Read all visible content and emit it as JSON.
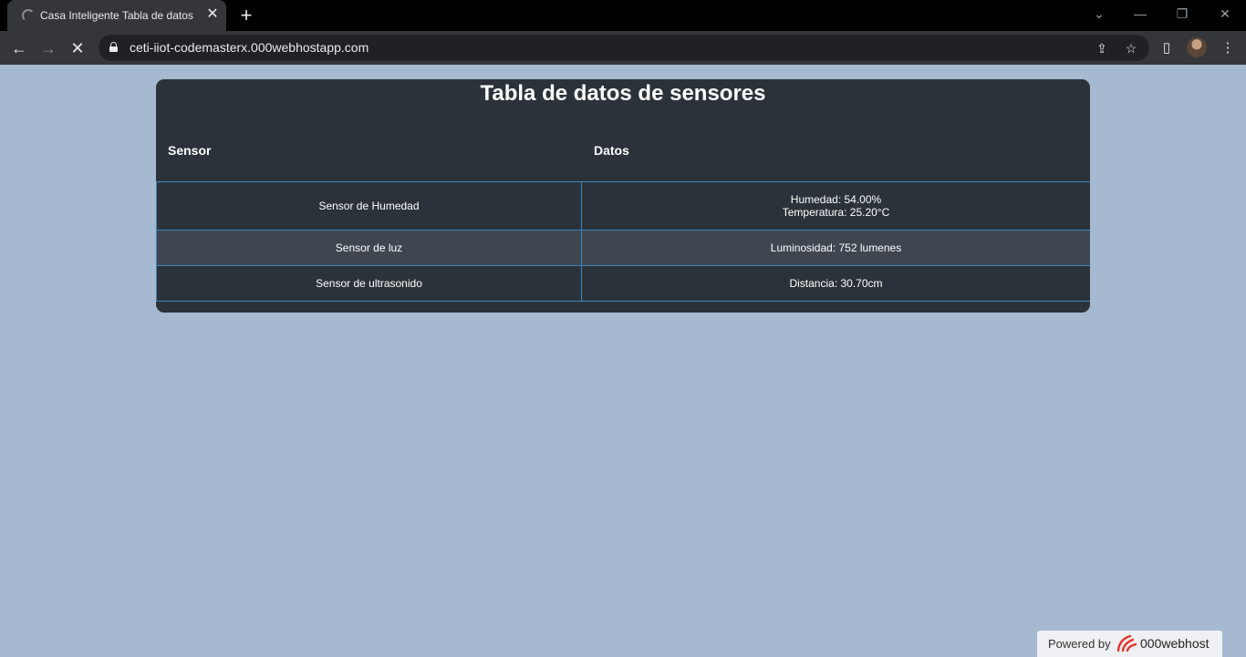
{
  "browser": {
    "tab_title": "Casa Inteligente Tabla de datos",
    "tab_close": "✕",
    "new_tab": "+",
    "url": "ceti-iiot-codemasterx.000webhostapp.com",
    "window_controls": {
      "tab_search": "⌄",
      "minimize": "—",
      "restore": "❐",
      "close": "✕"
    },
    "nav": {
      "back": "←",
      "forward": "→",
      "stop": "✕"
    },
    "icons": {
      "share": "⇪",
      "bookmark": "☆",
      "side_panel": "▯",
      "menu": "⋮"
    }
  },
  "page": {
    "title": "Tabla de datos de sensores",
    "columns": [
      "Sensor",
      "Datos"
    ],
    "rows": [
      {
        "sensor": "Sensor de Humedad",
        "datos_line1": "Humedad: 54.00%",
        "datos_line2": "Temperatura: 25.20°C"
      },
      {
        "sensor": "Sensor de luz",
        "datos_line1": "Luminosidad: 752 lumenes",
        "datos_line2": ""
      },
      {
        "sensor": "Sensor de ultrasonido",
        "datos_line1": "Distancia: 30.70cm",
        "datos_line2": ""
      }
    ]
  },
  "footer": {
    "powered_by": "Powered by",
    "host_name": "000webhost",
    "logo_color": "#e5332a"
  },
  "colors": {
    "page_background": "#a5b9d0",
    "card_background": "#2b3239",
    "row_alt_background": "#3f4650",
    "border_blue": "#3f87c0"
  }
}
